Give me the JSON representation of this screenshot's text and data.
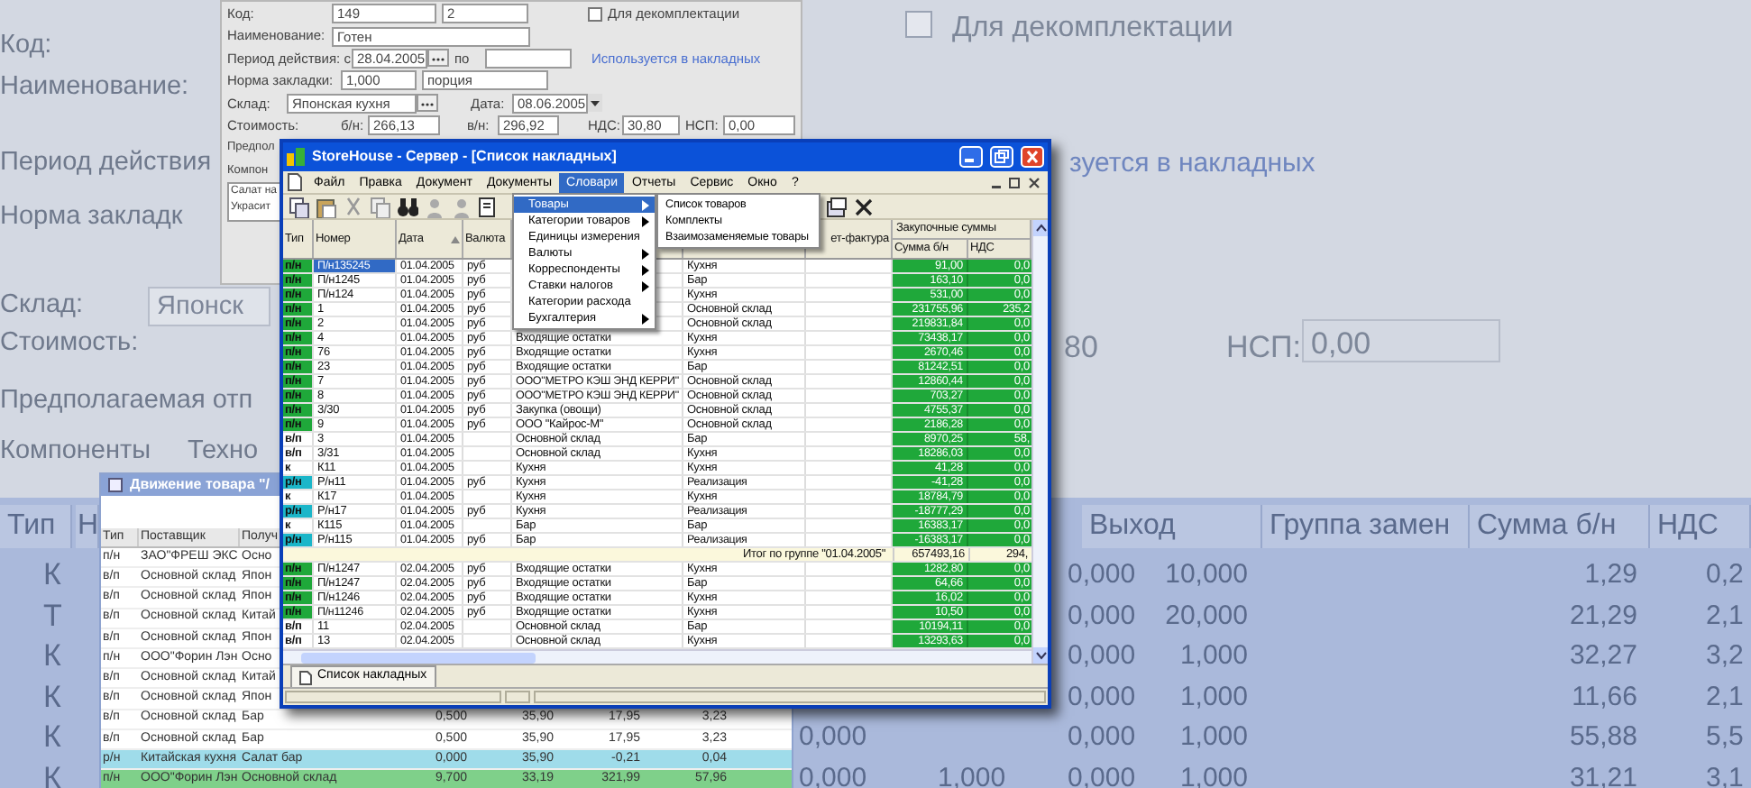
{
  "background": {
    "form_labels": [
      "Код:",
      "Наименование:",
      "Период действия",
      "Норма закладк",
      "Склад:",
      "Стоимость:",
      "Предполагаемая отп",
      "Компоненты",
      "Техно"
    ],
    "warehouse_field": "Японск",
    "decomplect": {
      "label": "Для декомплектации",
      "checked": false
    },
    "usage_link": "зуется в накладных",
    "cost_value": "80",
    "nsp_label": "НСП:",
    "nsp_value": "0,00",
    "table": {
      "columns": [
        "Тип",
        "Н",
        "Выход",
        "Группа замен",
        "Сумма б/н",
        "НДС"
      ],
      "rows": [
        {
          "type": "К",
          "col_a": "0,000",
          "output": "10,000",
          "sum": "1,29",
          "nds": "0,2"
        },
        {
          "type": "Т",
          "col_a": "0,000",
          "output": "20,000",
          "sum": "21,29",
          "nds": "2,1"
        },
        {
          "type": "К",
          "col_a": "0,000",
          "output": "1,000",
          "sum": "32,27",
          "nds": "3,2"
        },
        {
          "type": "К",
          "col_a": "0,000",
          "output": "1,000",
          "sum": "11,66",
          "nds": "2,1"
        },
        {
          "type": "К",
          "col_c": "0,000",
          "col_a": "0,000",
          "output": "1,000",
          "sum": "55,88",
          "nds": "5,5"
        },
        {
          "type": "К",
          "col_c": "0,000",
          "col_d": "1,000",
          "col_a": "0,000",
          "output": "1,000",
          "sum": "31,21",
          "nds": "3,1"
        }
      ]
    }
  },
  "product_window": {
    "code_label": "Код:",
    "code": "149",
    "code2": "2",
    "decomplect": {
      "label": "Для декомплектации",
      "checked": false
    },
    "name_label": "Наименование:",
    "name": "Готен",
    "period_label": "Период действия: с",
    "period_from": "28.04.2005",
    "to_label": "по",
    "usage_link": "Используется в накладных",
    "norm_label": "Норма закладки:",
    "norm": "1,000",
    "unit": "порция",
    "warehouse_label": "Склад:",
    "warehouse": "Японская кухня",
    "date_label": "Дата:",
    "date": "08.06.2005",
    "cost_label": "Стоимость:",
    "bn_label": "б/н:",
    "bn": "266,13",
    "vn_label": "в/н:",
    "vn": "296,92",
    "nds_label": "НДС:",
    "nds": "30,80",
    "nsp_label": "НСП:",
    "nsp": "0,00",
    "partial_labels": [
      "Предпол",
      "Компон"
    ],
    "components": [
      "Салат на",
      "Украсит"
    ]
  },
  "movement_window": {
    "title": "Движение товара \"/",
    "columns": [
      "Тип",
      "Поставщик",
      "Получ"
    ],
    "rows": [
      {
        "type": "п/н",
        "supplier": "ЗАО\"ФРЕШ ЭКС",
        "receiver": "Осно"
      },
      {
        "type": "в/п",
        "supplier": "Основной склад",
        "receiver": "Япон"
      },
      {
        "type": "в/п",
        "supplier": "Основной склад",
        "receiver": "Япон"
      },
      {
        "type": "в/п",
        "supplier": "Основной склад",
        "receiver": "Китай"
      },
      {
        "type": "в/п",
        "supplier": "Основной склад",
        "receiver": "Япон"
      },
      {
        "type": "п/н",
        "supplier": "ООО\"Форин Лэн",
        "receiver": "Осно"
      },
      {
        "type": "в/п",
        "supplier": "Основной склад",
        "receiver": "Китай"
      },
      {
        "type": "в/п",
        "supplier": "Основной склад",
        "receiver": "Япон"
      },
      {
        "type": "в/п",
        "supplier": "Основной склад",
        "receiver": "Бар",
        "values": [
          "0,500",
          "35,90",
          "17,95",
          "3,23"
        ]
      },
      {
        "type": "в/п",
        "supplier": "Основной склад",
        "receiver": "Бар",
        "values": [
          "0,500",
          "35,90",
          "17,95",
          "3,23"
        ]
      },
      {
        "type": "р/н",
        "supplier": "Китайская кухня",
        "receiver": "Салат бар",
        "values": [
          "0,000",
          "35,90",
          "-0,21",
          "0,04"
        ],
        "color": "#9fdcea"
      },
      {
        "type": "п/н",
        "supplier": "ООО\"Форин Лэн",
        "receiver": "Основной склад",
        "values": [
          "9,700",
          "33,19",
          "321,99",
          "57,96"
        ],
        "color": "#7fd08a"
      }
    ]
  },
  "main_window": {
    "title": "StoreHouse - Сервер - [Список накладных]",
    "menu": [
      {
        "label": "Файл",
        "selected": false
      },
      {
        "label": "Правка",
        "selected": false
      },
      {
        "label": "Документ",
        "selected": false
      },
      {
        "label": "Документы",
        "selected": false
      },
      {
        "label": "Словари",
        "selected": true
      },
      {
        "label": "Отчеты",
        "selected": false
      },
      {
        "label": "Сервис",
        "selected": false
      },
      {
        "label": "Окно",
        "selected": false
      },
      {
        "label": "?",
        "selected": false
      }
    ],
    "dropdown": [
      {
        "label": "Товары",
        "selected": true,
        "submenu": true
      },
      {
        "label": "Категории товаров",
        "selected": false,
        "submenu": true
      },
      {
        "label": "Единицы измерения",
        "selected": false,
        "submenu": false
      },
      {
        "label": "Валюты",
        "selected": false,
        "submenu": true
      },
      {
        "label": "Корреспонденты",
        "selected": false,
        "submenu": true
      },
      {
        "label": "Ставки налогов",
        "selected": false,
        "submenu": true
      },
      {
        "label": "Категории расхода",
        "selected": false,
        "submenu": false
      },
      {
        "label": "Бухгалтерия",
        "selected": false,
        "submenu": true
      }
    ],
    "submenu": [
      "Список товаров",
      "Комплекты",
      "Взаимозаменяемые товары"
    ],
    "columns": [
      "Тип",
      "Номер",
      "Дата",
      "Валюта",
      "ет-фактура"
    ],
    "group_header": "Закупочные суммы",
    "sub_columns": [
      "Сумма б/н",
      "НДС"
    ],
    "rows": [
      {
        "type": "п/н",
        "color": "#1fa83a",
        "number": "П/н135245",
        "selected": true,
        "date": "01.04.2005",
        "currency": "руб",
        "receiver": "Кухня",
        "sum": "91,00",
        "nds": "0,0"
      },
      {
        "type": "п/н",
        "color": "#1fa83a",
        "number": "П/н1245",
        "selected": false,
        "date": "01.04.2005",
        "currency": "руб",
        "receiver": "Бар",
        "sum": "163,10",
        "nds": "0,0"
      },
      {
        "type": "п/н",
        "color": "#1fa83a",
        "number": "П/н124",
        "selected": false,
        "date": "01.04.2005",
        "currency": "руб",
        "receiver": "Кухня",
        "sum": "531,00",
        "nds": "0,0"
      },
      {
        "type": "п/н",
        "color": "#1fa83a",
        "number": "1",
        "selected": false,
        "date": "01.04.2005",
        "currency": "руб",
        "receiver": "Основной склад",
        "sum": "231755,96",
        "nds": "235,2"
      },
      {
        "type": "п/н",
        "color": "#1fa83a",
        "number": "2",
        "selected": false,
        "date": "01.04.2005",
        "currency": "руб",
        "receiver": "Основной склад",
        "sum": "219831,84",
        "nds": "0,0"
      },
      {
        "type": "п/н",
        "color": "#1fa83a",
        "number": "4",
        "selected": false,
        "date": "01.04.2005",
        "currency": "руб",
        "supplier": "Входящие остатки",
        "receiver": "Кухня",
        "sum": "73438,17",
        "nds": "0,0"
      },
      {
        "type": "п/н",
        "color": "#1fa83a",
        "number": "76",
        "selected": false,
        "date": "01.04.2005",
        "currency": "руб",
        "supplier": "Входящие остатки",
        "receiver": "Кухня",
        "sum": "2670,46",
        "nds": "0,0"
      },
      {
        "type": "п/н",
        "color": "#1fa83a",
        "number": "23",
        "selected": false,
        "date": "01.04.2005",
        "currency": "руб",
        "supplier": "Входящие остатки",
        "receiver": "Бар",
        "sum": "81242,51",
        "nds": "0,0"
      },
      {
        "type": "п/н",
        "color": "#1fa83a",
        "number": "7",
        "selected": false,
        "date": "01.04.2005",
        "currency": "руб",
        "supplier": "ООО\"МЕТРО КЭШ ЭНД КЕРРИ\"",
        "receiver": "Основной склад",
        "sum": "12860,44",
        "nds": "0,0"
      },
      {
        "type": "п/н",
        "color": "#1fa83a",
        "number": "8",
        "selected": false,
        "date": "01.04.2005",
        "currency": "руб",
        "supplier": "ООО\"МЕТРО КЭШ ЭНД КЕРРИ\"",
        "receiver": "Основной склад",
        "sum": "703,27",
        "nds": "0,0"
      },
      {
        "type": "п/н",
        "color": "#1fa83a",
        "number": "3/30",
        "selected": false,
        "date": "01.04.2005",
        "currency": "руб",
        "supplier": "Закупка (овощи)",
        "receiver": "Основной склад",
        "sum": "4755,37",
        "nds": "0,0"
      },
      {
        "type": "п/н",
        "color": "#1fa83a",
        "number": "9",
        "selected": false,
        "date": "01.04.2005",
        "currency": "руб",
        "supplier": "ООО \"Кайрос-М\"",
        "receiver": "Основной склад",
        "sum": "2186,28",
        "nds": "0,0"
      },
      {
        "type": "в/п",
        "color": "#ffffff",
        "number": "3",
        "selected": false,
        "date": "01.04.2005",
        "supplier": "Основной склад",
        "receiver": "Бар",
        "sum": "8970,25",
        "nds": "58,"
      },
      {
        "type": "в/п",
        "color": "#ffffff",
        "number": "3/31",
        "selected": false,
        "date": "01.04.2005",
        "supplier": "Основной склад",
        "receiver": "Кухня",
        "sum": "18286,03",
        "nds": "0,0"
      },
      {
        "type": "к",
        "color": "#ffffff",
        "number": "К11",
        "selected": false,
        "date": "01.04.2005",
        "supplier": "Кухня",
        "receiver": "Кухня",
        "sum": "41,28",
        "nds": "0,0"
      },
      {
        "type": "р/н",
        "color": "#1bb6c9",
        "number": "Р/н11",
        "selected": false,
        "date": "01.04.2005",
        "currency": "руб",
        "supplier": "Кухня",
        "receiver": "Реализация",
        "sum": "-41,28",
        "nds": "0,0"
      },
      {
        "type": "к",
        "color": "#ffffff",
        "number": "К17",
        "selected": false,
        "date": "01.04.2005",
        "supplier": "Кухня",
        "receiver": "Кухня",
        "sum": "18784,79",
        "nds": "0,0"
      },
      {
        "type": "р/н",
        "color": "#1bb6c9",
        "number": "Р/н17",
        "selected": false,
        "date": "01.04.2005",
        "currency": "руб",
        "supplier": "Кухня",
        "receiver": "Реализация",
        "sum": "-18777,29",
        "nds": "0,0"
      },
      {
        "type": "к",
        "color": "#ffffff",
        "number": "К115",
        "selected": false,
        "date": "01.04.2005",
        "supplier": "Бар",
        "receiver": "Бар",
        "sum": "16383,17",
        "nds": "0,0"
      },
      {
        "type": "р/н",
        "color": "#1bb6c9",
        "number": "Р/н115",
        "selected": false,
        "date": "01.04.2005",
        "currency": "руб",
        "supplier": "Бар",
        "receiver": "Реализация",
        "sum": "-16383,17",
        "nds": "0,0"
      },
      {
        "kind": "group",
        "label": "Итог по группе \"01.04.2005\"",
        "sum": "657493,16",
        "nds": "294,"
      },
      {
        "type": "п/н",
        "color": "#1fa83a",
        "number": "П/н1247",
        "selected": false,
        "date": "02.04.2005",
        "currency": "руб",
        "supplier": "Входящие остатки",
        "receiver": "Кухня",
        "sum": "1282,80",
        "nds": "0,0"
      },
      {
        "type": "п/н",
        "color": "#1fa83a",
        "number": "П/н1247",
        "selected": false,
        "date": "02.04.2005",
        "currency": "руб",
        "supplier": "Входящие остатки",
        "receiver": "Бар",
        "sum": "64,66",
        "nds": "0,0"
      },
      {
        "type": "п/н",
        "color": "#1fa83a",
        "number": "П/н1246",
        "selected": false,
        "date": "02.04.2005",
        "currency": "руб",
        "supplier": "Входящие остатки",
        "receiver": "Кухня",
        "sum": "16,02",
        "nds": "0,0"
      },
      {
        "type": "п/н",
        "color": "#1fa83a",
        "number": "П/н11246",
        "selected": false,
        "date": "02.04.2005",
        "currency": "руб",
        "supplier": "Входящие остатки",
        "receiver": "Кухня",
        "sum": "10,50",
        "nds": "0,0"
      },
      {
        "type": "в/п",
        "color": "#ffffff",
        "number": "11",
        "selected": false,
        "date": "02.04.2005",
        "supplier": "Основной склад",
        "receiver": "Бар",
        "sum": "10194,11",
        "nds": "0,0"
      },
      {
        "type": "в/п",
        "color": "#ffffff",
        "number": "13",
        "selected": false,
        "date": "02.04.2005",
        "supplier": "Основной склад",
        "receiver": "Кухня",
        "sum": "13293,63",
        "nds": "0,0"
      }
    ],
    "tab": "Список накладных"
  }
}
